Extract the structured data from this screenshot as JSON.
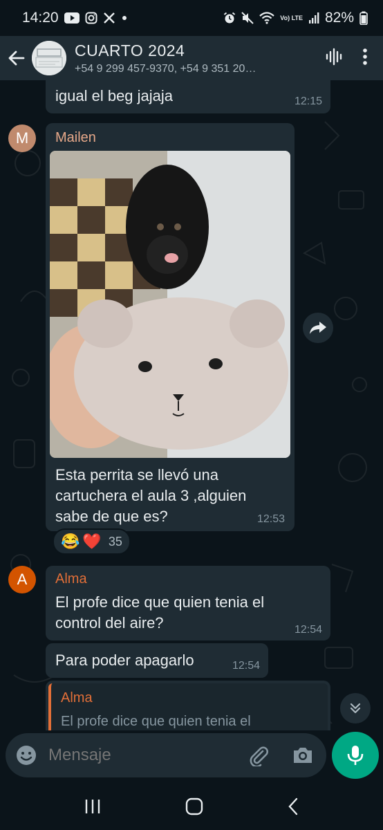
{
  "status_bar": {
    "time": "14:20",
    "battery": "82%",
    "app_icons": [
      "youtube-icon",
      "instagram-icon",
      "x-icon",
      "dot-icon"
    ],
    "system_icons": [
      "alarm-icon",
      "mute-icon",
      "wifi-icon",
      "volte-icon",
      "signal-icon",
      "battery-icon"
    ],
    "volte_label": "Vo) LTE"
  },
  "header": {
    "title": "CUARTO 2024",
    "subtitle": "+54 9 299 457-9370, +54 9 351 20…",
    "icons": [
      "back-arrow-icon",
      "group-avatar",
      "voice-call-waveform-icon",
      "more-vertical-icon"
    ]
  },
  "messages": [
    {
      "text": "igual el beg jajaja",
      "time": "12:15"
    },
    {
      "sender": "Mailen",
      "avatar_letter": "M",
      "text": "Esta perrita se llevó una cartuchera el aula 3 ,alguien sabe de que es?",
      "time": "12:53",
      "image": "photo of black dog behind plush bear-face pencil case held in hand",
      "reactions": {
        "emojis": [
          "😂",
          "❤️"
        ],
        "count": "35"
      }
    },
    {
      "sender": "Alma",
      "avatar_letter": "A",
      "text": "El profe dice que quien tenia el control del aire?",
      "time": "12:54"
    },
    {
      "text": "Para poder apagarlo",
      "time": "12:54"
    },
    {
      "reply_to": {
        "name": "Alma",
        "text": "El profe dice que quien tenia el"
      }
    }
  ],
  "input": {
    "placeholder": "Mensaje",
    "icons": [
      "emoji-icon",
      "attach-icon",
      "camera-icon",
      "mic-icon"
    ]
  },
  "colors": {
    "background": "#0b141a",
    "bubble": "#1f2c34",
    "accent_green": "#00a884",
    "mailen_name": "#e6a889",
    "alma_name": "#e26f38",
    "mailen_avatar": "#c08a6d",
    "alma_avatar": "#d35400"
  }
}
